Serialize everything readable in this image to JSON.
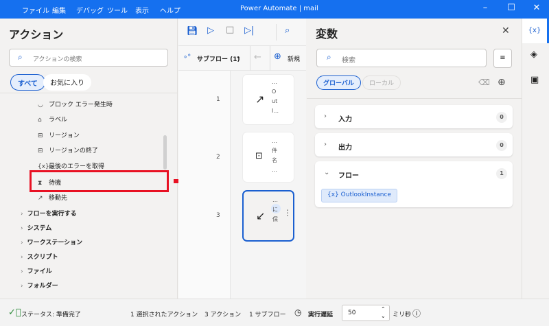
{
  "window": {
    "title": "Power Automate | mail",
    "menu": [
      "ファイル",
      "編集",
      "デバッグ",
      "ツール",
      "表示",
      "ヘルプ"
    ],
    "minimize": "–",
    "maximize": "☐",
    "close": "✕"
  },
  "actions": {
    "title": "アクション",
    "search_placeholder": "アクションの検索",
    "filters": [
      "すべて",
      "お気に入り"
    ],
    "items": [
      {
        "label": "ブロック エラー発生時",
        "icon": "shield-icon"
      },
      {
        "label": "ラベル",
        "icon": "label-icon"
      },
      {
        "label": "リージョン",
        "icon": "region-icon"
      },
      {
        "label": "リージョンの終了",
        "icon": "region-end-icon"
      },
      {
        "label": "最後のエラーを取得",
        "icon": "variable-icon"
      },
      {
        "label": "待機",
        "icon": "hourglass-icon"
      },
      {
        "label": "移動先",
        "icon": "goto-icon"
      }
    ],
    "categories": [
      "フローを実行する",
      "システム",
      "ワークステーション",
      "スクリプト",
      "ファイル",
      "フォルダー"
    ]
  },
  "flow": {
    "subflow_label": "サブフロー (1)",
    "new_label": "新規",
    "steps": [
      {
        "number": "1",
        "lines": [
          "…",
          "O",
          "ut",
          "I..."
        ]
      },
      {
        "number": "2",
        "lines": [
          "…",
          "件",
          "名",
          "…"
        ]
      },
      {
        "number": "3",
        "lines": [
          "…",
          "",
          "に",
          "保"
        ]
      }
    ]
  },
  "variables": {
    "title": "変数",
    "search_placeholder": "検索",
    "scopes": [
      "グローバル",
      "ローカル"
    ],
    "sections": [
      {
        "label": "入力",
        "count": "0",
        "expanded": false
      },
      {
        "label": "出力",
        "count": "0",
        "expanded": false
      },
      {
        "label": "フロー",
        "count": "1",
        "expanded": true
      }
    ],
    "flow_variables": [
      "OutlookInstance"
    ]
  },
  "status": {
    "text": "ステータス: 準備完了",
    "selected": "1 選択されたアクション",
    "actions": "3 アクション",
    "subflows": "1 サブフロー",
    "delay_label": "実行遅延",
    "delay_value": "50",
    "unit": "ミリ秒"
  },
  "colors": {
    "accent": "#1570ef",
    "highlight": "#e81123"
  }
}
